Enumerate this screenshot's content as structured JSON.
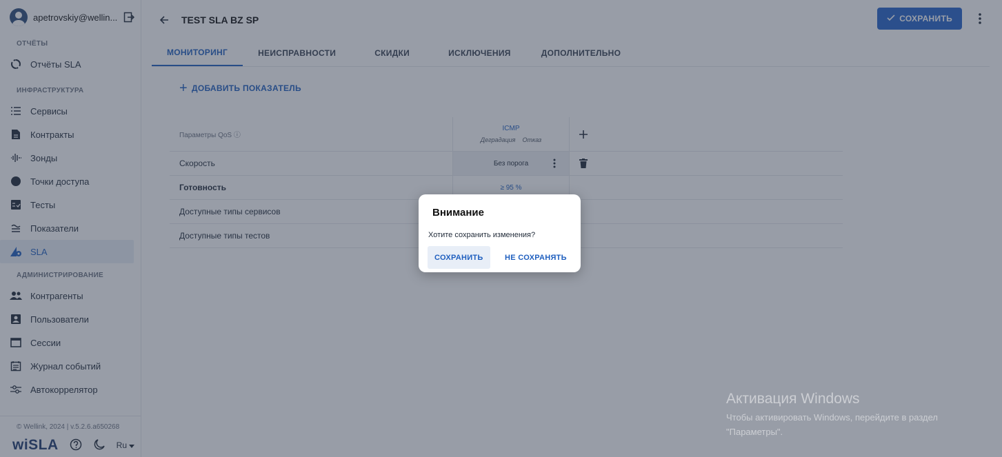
{
  "user": {
    "email": "apetrovskiy@wellin..."
  },
  "sidebar": {
    "sections": [
      {
        "title": "ОТЧЁТЫ",
        "items": [
          {
            "label": "Отчёты SLA",
            "icon": "circle-arrows-icon"
          }
        ]
      },
      {
        "title": "ИНФРАСТРУКТУРА",
        "items": [
          {
            "label": "Сервисы",
            "icon": "list-icon"
          },
          {
            "label": "Контракты",
            "icon": "document-icon"
          },
          {
            "label": "Зонды",
            "icon": "waveform-icon"
          },
          {
            "label": "Точки доступа",
            "icon": "dot-icon"
          },
          {
            "label": "Тесты",
            "icon": "test-icon"
          },
          {
            "label": "Показатели",
            "icon": "approx-icon"
          },
          {
            "label": "SLA",
            "icon": "sla-icon"
          }
        ]
      },
      {
        "title": "АДМИНИСТРИРОВАНИЕ",
        "items": [
          {
            "label": "Контрагенты",
            "icon": "people-icon"
          },
          {
            "label": "Пользователи",
            "icon": "user-card-icon"
          },
          {
            "label": "Сессии",
            "icon": "window-icon"
          },
          {
            "label": "Журнал событий",
            "icon": "calendar-icon"
          },
          {
            "label": "Автокоррелятор",
            "icon": "sliders-icon"
          }
        ]
      }
    ],
    "version": "© Wellink, 2024 | v.5.2.6.a650268",
    "logo": "wiSLA",
    "language": "Ru"
  },
  "header": {
    "title": "TEST SLA BZ SP",
    "save_label": "СОХРАНИТЬ"
  },
  "tabs": [
    "МОНИТОРИНГ",
    "НЕИСПРАВНОСТИ",
    "СКИДКИ",
    "ИСКЛЮЧЕНИЯ",
    "ДОПОЛНИТЕЛЬНО"
  ],
  "add_indicator_label": "ДОБАВИТЬ ПОКАЗАТЕЛЬ",
  "table": {
    "header_label": "Параметры QoS ⓘ",
    "column": {
      "title": "ICMP",
      "sub_degradation": "Деградация",
      "sub_failure": "Отказ"
    },
    "rows": [
      {
        "name": "Скорость",
        "value": "Без порога"
      },
      {
        "name": "Готовность",
        "value": "≥ 95 %"
      },
      {
        "name": "Доступные типы сервисов",
        "value": ""
      },
      {
        "name": "Доступные типы тестов",
        "value": ""
      }
    ]
  },
  "dialog": {
    "title": "Внимание",
    "text": "Хотите сохранить изменения?",
    "save_label": "СОХРАНИТЬ",
    "dont_save_label": "НЕ СОХРАНЯТЬ"
  },
  "watermark": {
    "title": "Активация Windows",
    "text": "Чтобы активировать Windows, перейдите в раздел \"Параметры\"."
  },
  "colors": {
    "accent": "#2563c9",
    "overlay": "rgba(50,60,80,0.5)"
  }
}
